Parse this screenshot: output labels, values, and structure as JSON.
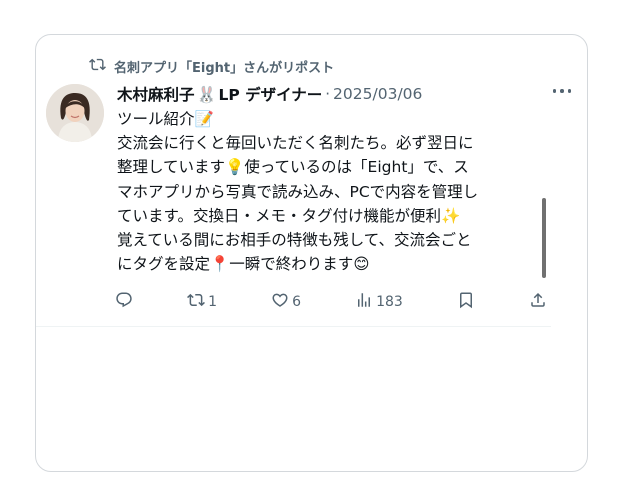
{
  "repost": {
    "text": "名刺アプリ「Eight」さんがリポスト"
  },
  "author": {
    "name": "木村麻利子",
    "emoji": "🐰",
    "suffix": "LP デザイナー",
    "date": "2025/03/06"
  },
  "tweet": {
    "lines": [
      "ツール紹介📝",
      "交流会に行くと毎回いただく名刺たち。必ず翌日に",
      "整理しています💡使っているのは「Eight」で、ス",
      "マホアプリから写真で読み込み、PCで内容を管理し",
      "ています。交換日・メモ・タグ付け機能が便利✨",
      "覚えている間にお相手の特徴も残して、交流会ごと",
      "にタグを設定📍一瞬で終わります😊"
    ]
  },
  "actions": {
    "reply": "",
    "repost_count": "1",
    "like_count": "6",
    "views_count": "183"
  },
  "colors": {
    "text": "#0f1419",
    "muted": "#536471",
    "border": "#d4d8dc"
  },
  "icons": [
    "repost-icon",
    "reply-icon",
    "like-icon",
    "views-icon",
    "bookmark-icon",
    "share-icon",
    "more-icon"
  ]
}
